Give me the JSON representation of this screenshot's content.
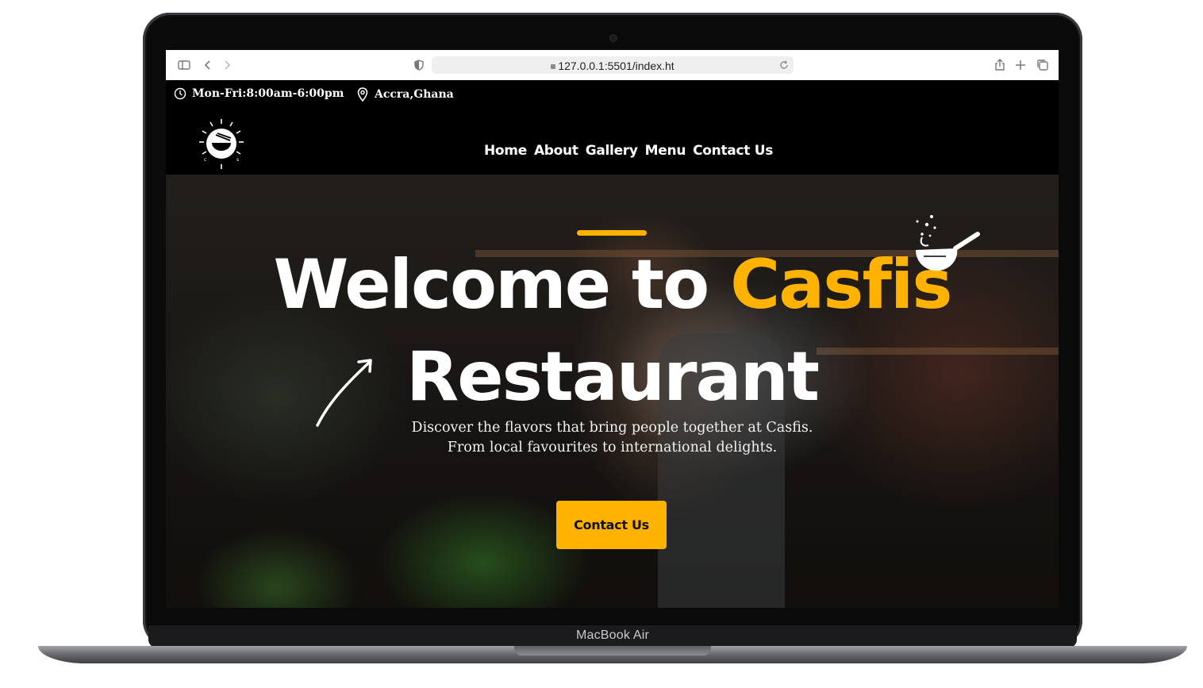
{
  "device": {
    "label": "MacBook Air"
  },
  "browser": {
    "url": "127.0.0.1:5501/index.ht",
    "icons": [
      "sidebar-icon",
      "back-icon",
      "forward-icon",
      "privacy-shield-icon",
      "reload-icon",
      "share-icon",
      "new-tab-icon",
      "tabs-overview-icon"
    ]
  },
  "infobar": {
    "hours": "Mon-Fri:8:00am-6:00pm",
    "location": "Accra,Ghana"
  },
  "nav": {
    "links": [
      "Home",
      "About",
      "Gallery",
      "Menu",
      "Contact Us"
    ]
  },
  "hero": {
    "title_part1": "Welcome to ",
    "title_highlight": "Casfis",
    "title_line2": "Restaurant",
    "subtitle_line1": "Discover the flavors that bring people together at Casfis.",
    "subtitle_line2": "From local favourites to international delights.",
    "cta_label": "Contact Us"
  },
  "colors": {
    "accent": "#ffb300",
    "nav_background": "#000000",
    "text": "#ffffff"
  }
}
